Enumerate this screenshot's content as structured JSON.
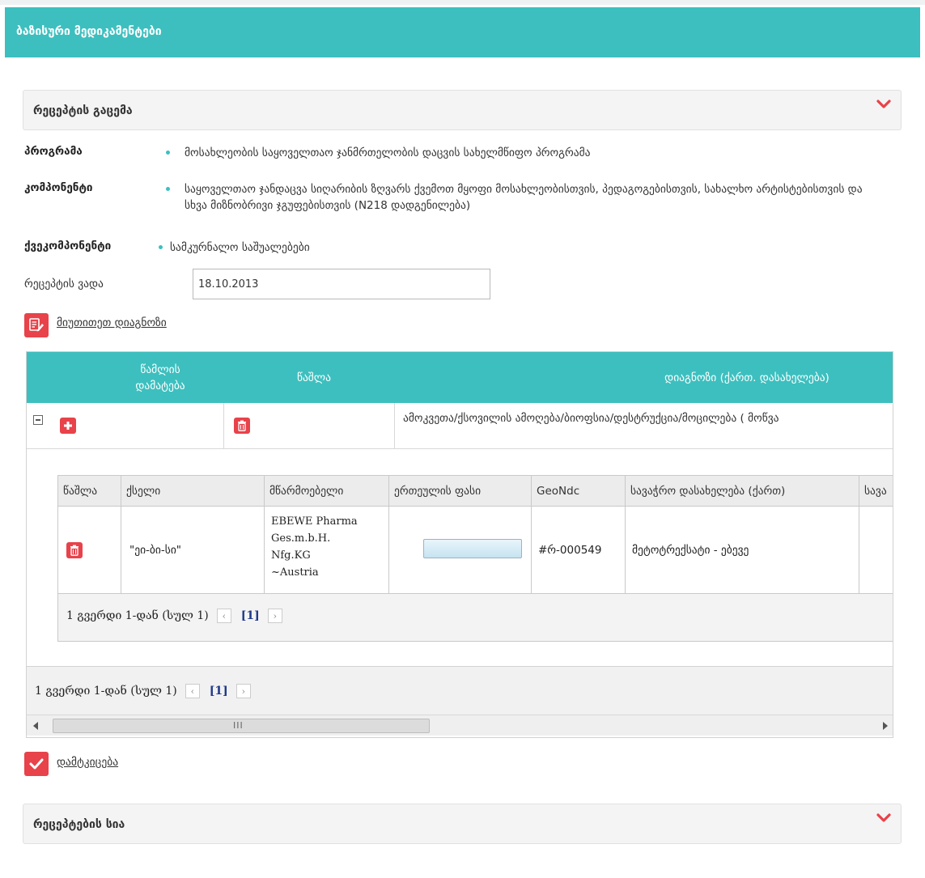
{
  "header": {
    "title": "ბაზისური მედიკამენტები"
  },
  "prescription_section": {
    "title": "რეცეპტის გაცემა"
  },
  "info": {
    "program_label": "პროგრამა",
    "program_value": "მოსახლეობის საყოველთაო ჯანმრთელობის დაცვის სახელმწიფო პროგრამა",
    "component_label": "კომპონენტი",
    "component_value": "საყოველთაო ჯანდაცვა სიღარიბის ზღვარს ქვემოთ მყოფი მოსახლეობისთვის, პედაგოგებისთვის, სახალხო არტისტებისთვის და სხვა მიზნობრივი ჯგუფებისთვის (N218 დადგენილება)",
    "subcomponent_label": "ქვეკომპონენტი",
    "subcomponent_value": "სამკურნალო საშუალებები"
  },
  "validity": {
    "label": "რეცეპტის ვადა",
    "value": "18.10.2013"
  },
  "diagnosis_action": {
    "label": "მიუთითეთ დიაგნოზი"
  },
  "outer_grid": {
    "columns": [
      "წამლის დამატება",
      "წაშლა",
      "დიაგნოზი (ქართ. დასახელება)"
    ],
    "row_diagnosis": "ამოკვეთა/ქსოვილის ამოღება/ბიოფსია/დესტრუქცია/მოცილება ( მოწვა",
    "pager": {
      "text": "1 გვერდი 1-დან (სულ 1)",
      "page": "[1]"
    }
  },
  "inner_grid": {
    "columns": [
      "წაშლა",
      "ქსელი",
      "მწარმოებელი",
      "ერთეულის ფასი",
      "GeoNdc",
      "სავაჭრო დასახელება (ქართ)",
      "სავა"
    ],
    "row": {
      "network": "\"ეი-ბი-სი\"",
      "manufacturer": [
        "EBEWE Pharma",
        "Ges.m.b.H.",
        "Nfg.KG",
        "~Austria"
      ],
      "geondc": "#რ-000549",
      "trade_name": "მეტოტრექსატი - ებევე"
    },
    "pager": {
      "text": "1 გვერდი 1-დან (სულ 1)",
      "page": "[1]"
    }
  },
  "scrollbar": {
    "grip": "III"
  },
  "confirm_action": {
    "label": "დამტკიცება"
  },
  "prescriptions_list": {
    "title": "რეცეპტების სია"
  }
}
